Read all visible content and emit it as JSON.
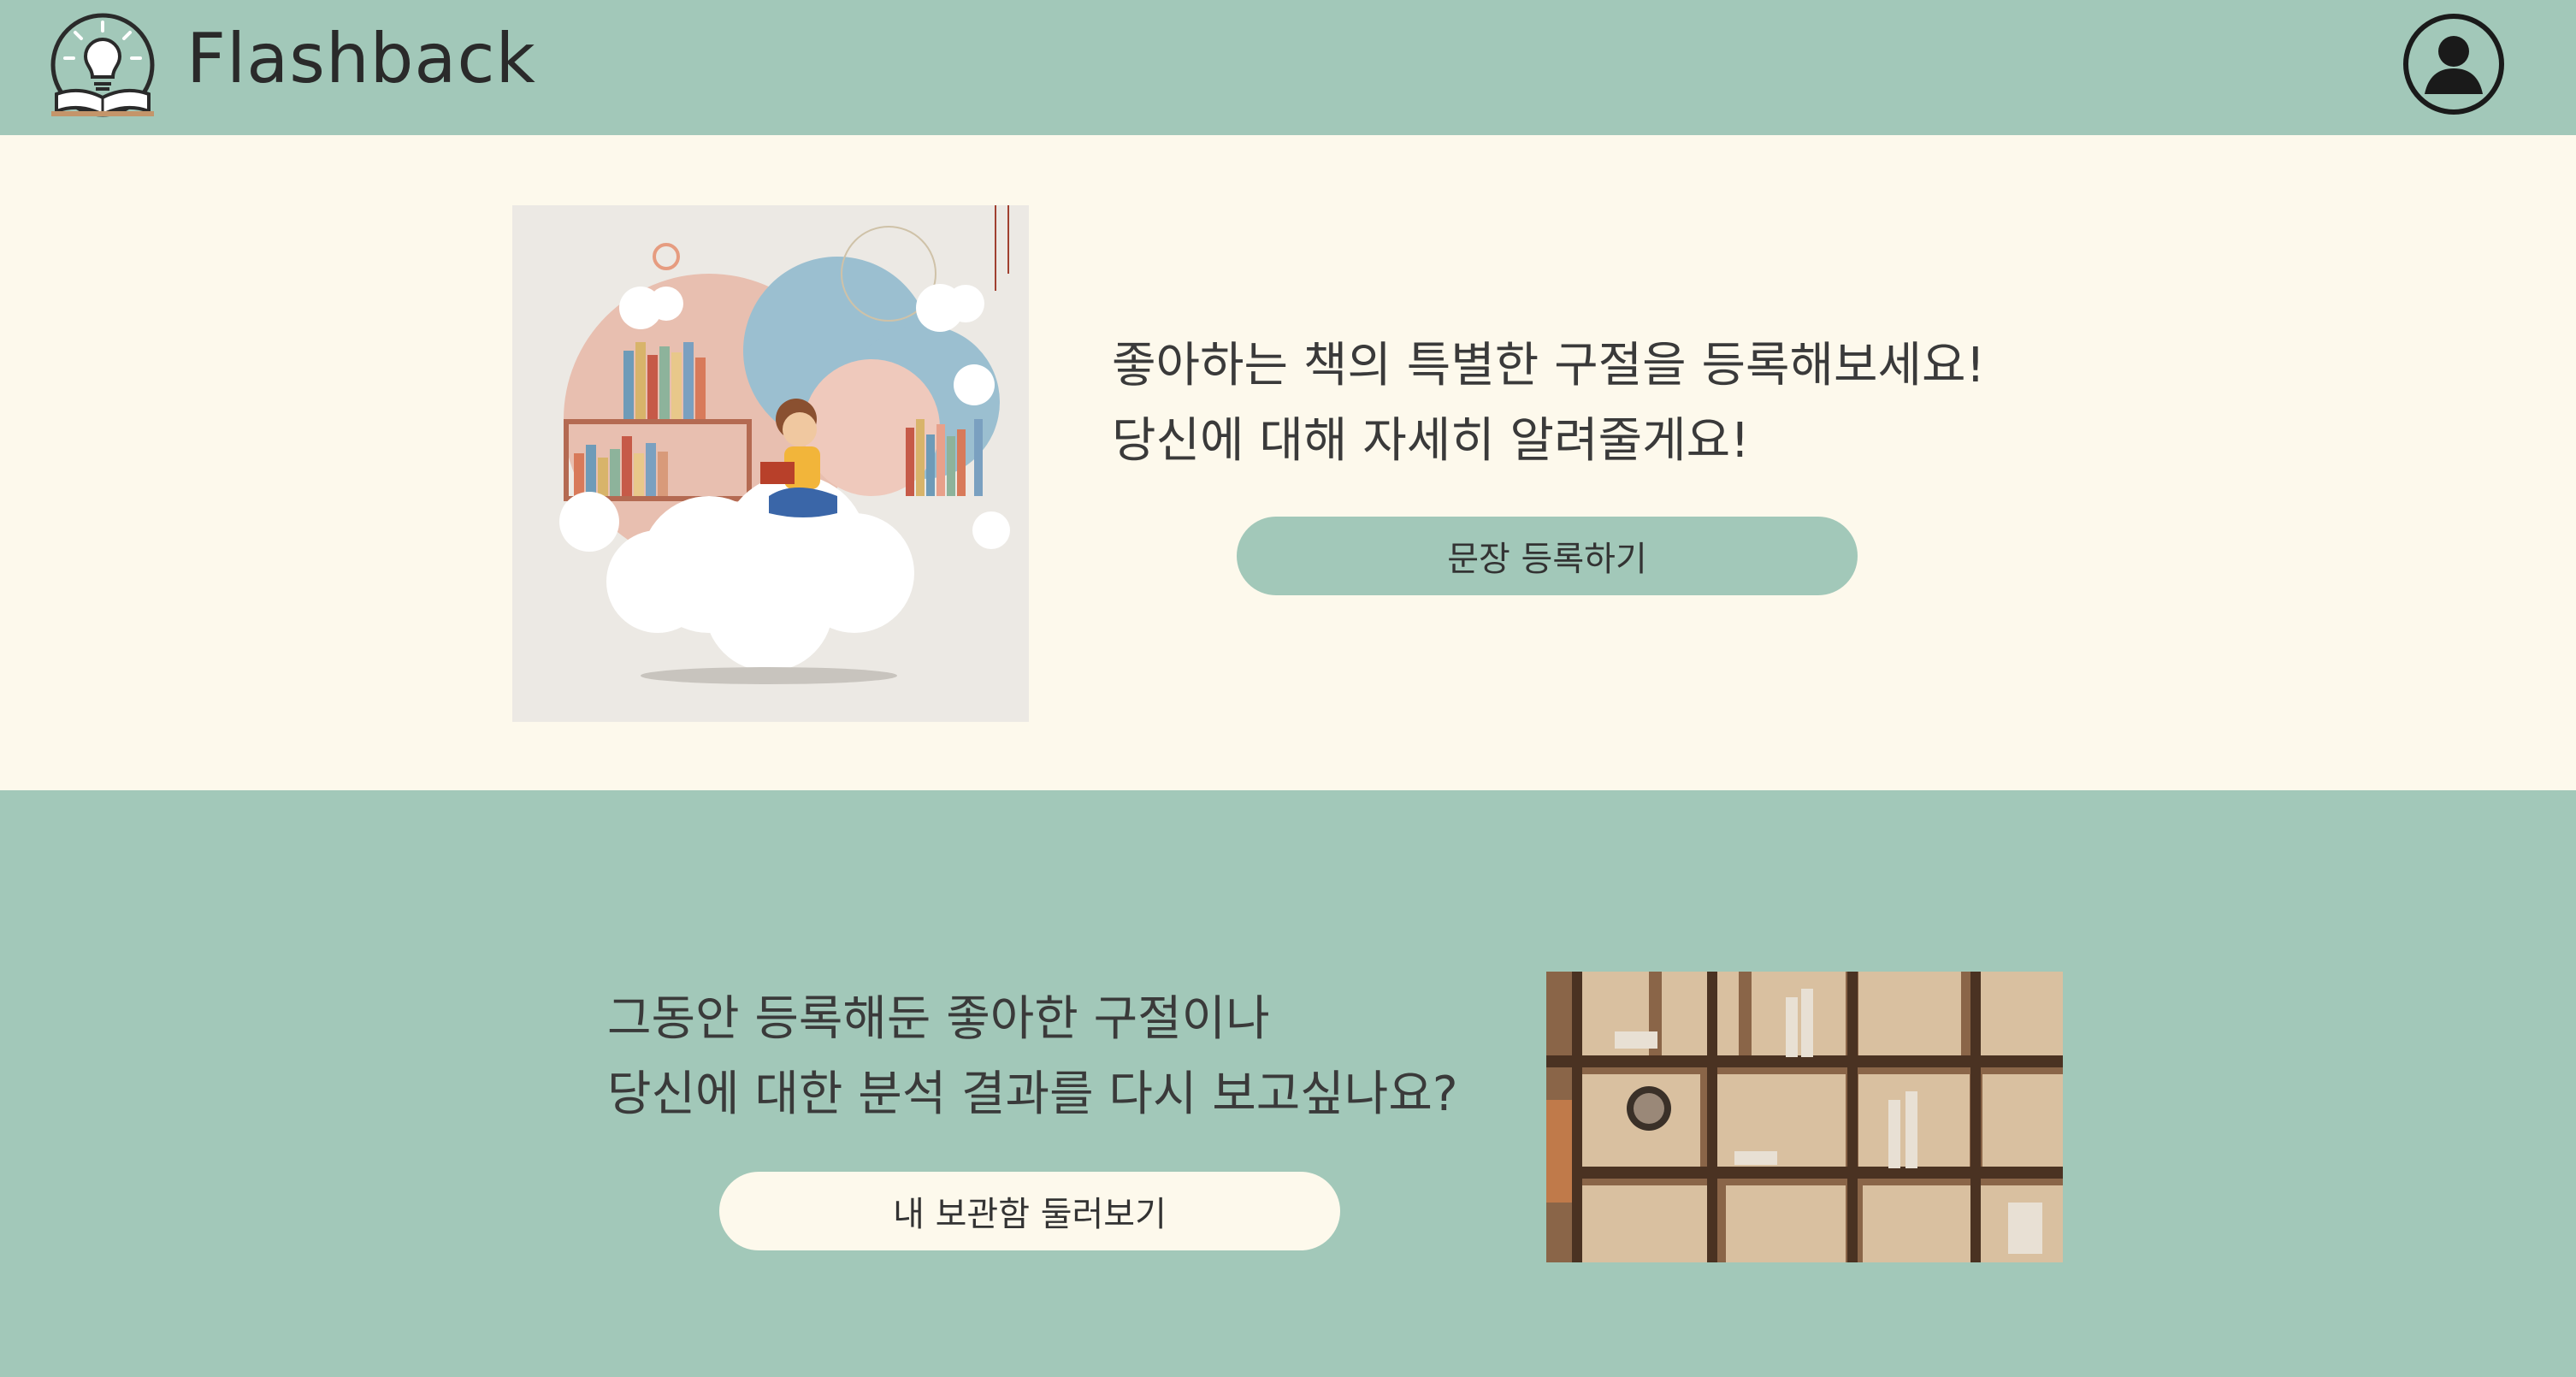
{
  "header": {
    "brand": "Flashback",
    "logo_icon": "lightbulb-book-logo",
    "profile_icon": "user-profile-icon"
  },
  "section1": {
    "line1": "좋아하는 책의 특별한 구절을 등록해보세요!",
    "line2": "당신에 대해 자세히 알려줄게요!",
    "button_label": "문장 등록하기",
    "image": "illustration-child-reading-on-cloud-bookshelf"
  },
  "section2": {
    "line1": "그동안 등록해둔 좋아한 구절이나",
    "line2": "당신에 대한 분석 결과를 다시 보고싶나요?",
    "button_label": "내 보관함 둘러보기",
    "image": "photo-wooden-bookshelf"
  },
  "colors": {
    "accent": "#a2c8b9",
    "cream": "#fdf9ec",
    "text": "#3a3a3a"
  }
}
